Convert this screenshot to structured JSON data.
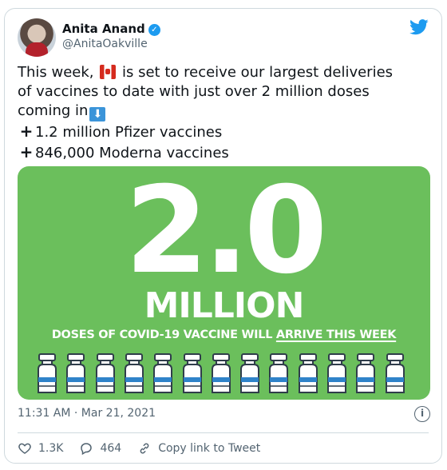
{
  "author": {
    "name": "Anita Anand",
    "handle": "@AnitaOakville"
  },
  "tweet": {
    "line1_pre": "This week,",
    "line1_post": "is set to receive our largest deliveries",
    "line2": "of vaccines to date with just over 2 million doses",
    "line3": "coming in",
    "line4": "1.2 million Pfizer vaccines",
    "line5": "846,000 Moderna vaccines"
  },
  "media": {
    "big_number": "2.0",
    "million": "MILLION",
    "doses_pre": "DOSES OF COVID-19 VACCINE WILL ",
    "doses_underlined": "ARRIVE THIS WEEK",
    "background_color": "#6bbf5c"
  },
  "meta": {
    "timestamp": "11:31 AM · Mar 21, 2021"
  },
  "actions": {
    "likes": "1.3K",
    "replies": "464",
    "copy_link": "Copy link to Tweet"
  },
  "icons": [
    "verified-badge-icon",
    "twitter-bird-icon",
    "canada-flag-emoji",
    "down-arrow-emoji",
    "plus-icon",
    "info-icon",
    "heart-icon",
    "reply-icon",
    "link-icon"
  ],
  "colors": {
    "accent": "#1d9bf0",
    "secondary_text": "#536471",
    "border": "#cfd9de"
  }
}
